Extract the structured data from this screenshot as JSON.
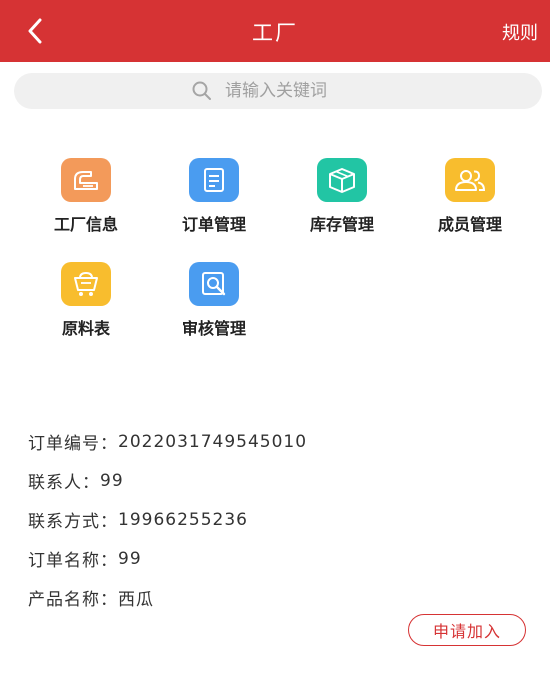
{
  "header": {
    "title": "工厂",
    "rules_label": "规则",
    "bg_color": "#d63334"
  },
  "search": {
    "placeholder": "请输入关键词"
  },
  "menu": [
    {
      "label": "工厂信息",
      "icon": "factory-icon",
      "color": "#f39a5a"
    },
    {
      "label": "订单管理",
      "icon": "document-icon",
      "color": "#4a9cf0"
    },
    {
      "label": "库存管理",
      "icon": "box-icon",
      "color": "#22c5a4"
    },
    {
      "label": "成员管理",
      "icon": "users-icon",
      "color": "#f8bd2e"
    },
    {
      "label": "原料表",
      "icon": "cart-icon",
      "color": "#f8bd2e"
    },
    {
      "label": "审核管理",
      "icon": "review-icon",
      "color": "#4a9cf0"
    }
  ],
  "order": {
    "number_label": "订单编号：",
    "number": "2022031749545010",
    "contact_label": "联系人：",
    "contact": "99",
    "phone_label": "联系方式：",
    "phone": "19966255236",
    "name_label": "订单名称：",
    "name": "99",
    "product_label": "产品名称：",
    "product": "西瓜"
  },
  "apply_label": "申请加入"
}
